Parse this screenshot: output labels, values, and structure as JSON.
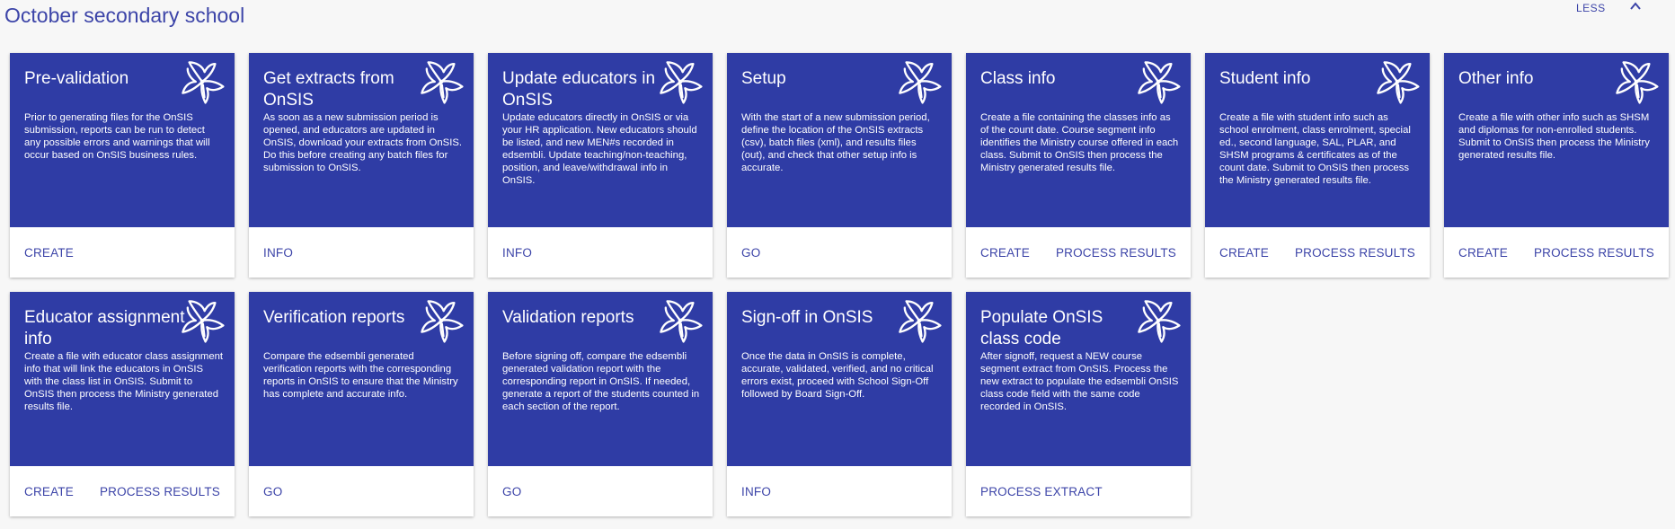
{
  "header": {
    "title": "October secondary school",
    "toggle_label": "LESS"
  },
  "icons": {
    "card_logo": "trillium-icon",
    "toggle": "chevron-up-icon"
  },
  "colors": {
    "card_bg": "#2f3ca5",
    "accent": "#3c44a8"
  },
  "cards": [
    {
      "title": "Pre-validation",
      "description": "Prior to generating files for the OnSIS submission, reports can be run to detect any possible errors and warnings that will occur based on OnSIS business rules.",
      "actions": [
        "CREATE"
      ]
    },
    {
      "title": "Get extracts from OnSIS",
      "description": "As soon as a new submission period is opened, and educators are updated in OnSIS, download your extracts from OnSIS. Do this before creating any batch files for submission to OnSIS.",
      "actions": [
        "INFO"
      ]
    },
    {
      "title": "Update educators in OnSIS",
      "description": "Update educators directly in OnSIS or via your HR application. New educators should be listed, and new MEN#s recorded in edsembli. Update teaching/non-teaching, position, and leave/withdrawal info in OnSIS.",
      "actions": [
        "INFO"
      ]
    },
    {
      "title": "Setup",
      "description": "With the start of a new submission period, define the location of the OnSIS extracts (csv), batch files (xml), and results files (out), and check that other setup info is accurate.",
      "actions": [
        "GO"
      ]
    },
    {
      "title": "Class info",
      "description": "Create a file containing the classes info as of the count date. Course segment info identifies the Ministry course offered in each class. Submit to OnSIS then process the Ministry generated results file.",
      "actions": [
        "CREATE",
        "PROCESS RESULTS"
      ]
    },
    {
      "title": "Student info",
      "description": "Create a file with student info such as school enrolment, class enrolment, special ed., second language, SAL, PLAR, and SHSM programs & certificates as of the count date. Submit to OnSIS then process the Ministry generated results file.",
      "actions": [
        "CREATE",
        "PROCESS RESULTS"
      ]
    },
    {
      "title": "Other info",
      "description": "Create a file with other info such as SHSM and diplomas for non-enrolled students. Submit to OnSIS then process the Ministry generated results file.",
      "actions": [
        "CREATE",
        "PROCESS RESULTS"
      ]
    },
    {
      "title": "Educator assignment info",
      "description": "Create a file with educator class assignment info that will link the educators in OnSIS with the class list in OnSIS. Submit to OnSIS then process the Ministry generated results file.",
      "actions": [
        "CREATE",
        "PROCESS RESULTS"
      ]
    },
    {
      "title": "Verification reports",
      "description": "Compare the edsembli generated verification reports with the corresponding reports in OnSIS to ensure that the Ministry has complete and accurate info.",
      "actions": [
        "GO"
      ]
    },
    {
      "title": "Validation reports",
      "description": "Before signing off, compare the edsembli generated validation report with the corresponding report in OnSIS. If needed, generate a report of the students counted in each section of the report.",
      "actions": [
        "GO"
      ]
    },
    {
      "title": "Sign-off in OnSIS",
      "description": "Once the data in OnSIS is complete, accurate, validated, verified, and no critical errors exist, proceed with School Sign-Off followed by Board Sign-Off.",
      "actions": [
        "INFO"
      ]
    },
    {
      "title": "Populate OnSIS class code",
      "description": "After signoff, request a NEW course segment extract from OnSIS. Process the new extract to populate the edsembli OnSIS class code field with the same code recorded in OnSIS.",
      "actions": [
        "PROCESS EXTRACT"
      ]
    }
  ]
}
